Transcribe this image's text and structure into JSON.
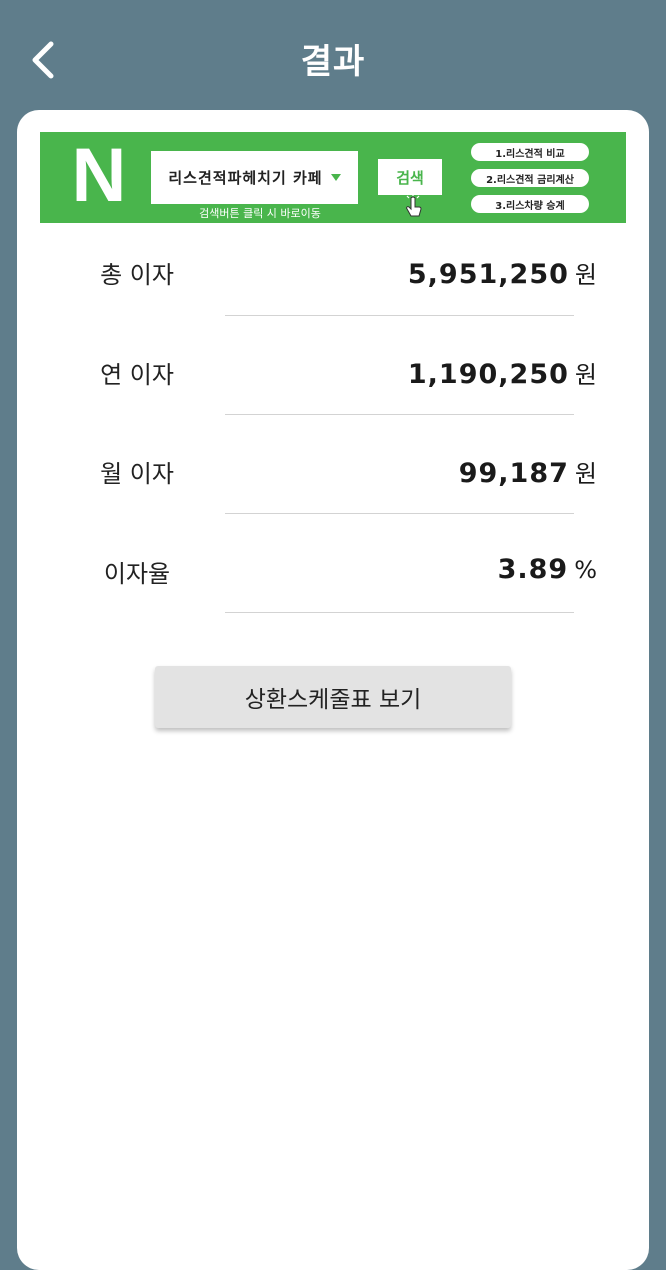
{
  "header": {
    "title": "결과"
  },
  "ad_banner": {
    "logo": "N",
    "query": "리스견적파헤치기 카페",
    "hint": "검색버튼 클릭 시 바로이동",
    "search_label": "검색",
    "menu_items": [
      "1.리스견적 비교",
      "2.리스견적 금리계산",
      "3.리스차량 승계"
    ],
    "brand_color": "#49b54c"
  },
  "results": [
    {
      "label": "총 이자",
      "value": "5,951,250",
      "unit": "원"
    },
    {
      "label": "연 이자",
      "value": "1,190,250",
      "unit": "원"
    },
    {
      "label": "월 이자",
      "value": "99,187",
      "unit": "원"
    },
    {
      "label": "이자율",
      "value": "3.89",
      "unit": "%"
    }
  ],
  "schedule_button_label": "상환스케줄표 보기",
  "colors": {
    "background": "#5f7d8b",
    "card": "#ffffff",
    "button": "#e3e3e3"
  }
}
